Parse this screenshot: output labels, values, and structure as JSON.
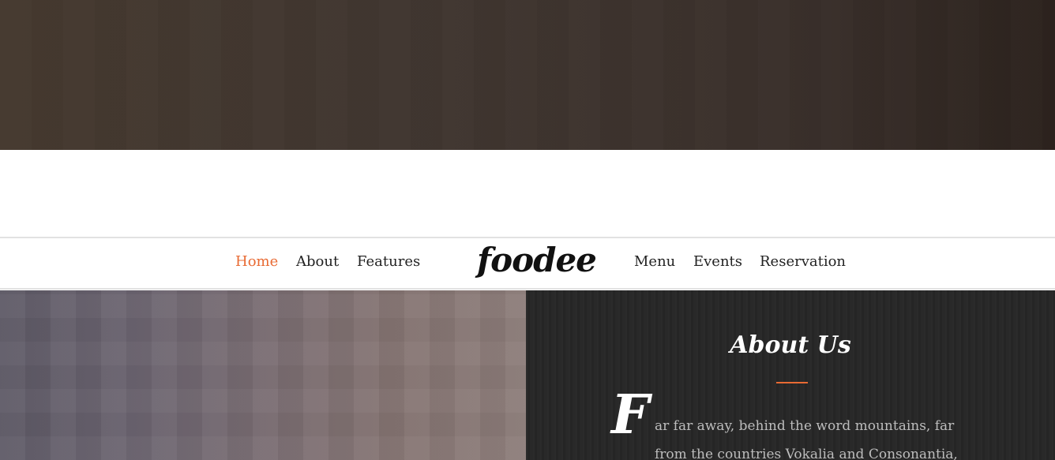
{
  "navbar": {
    "left_links": [
      "Home",
      "About",
      "Features"
    ],
    "logo": "foodee",
    "right_links": [
      "Menu",
      "Events",
      "Reservation"
    ],
    "active_link": "Home"
  },
  "about": {
    "title": "About Us",
    "drop_cap": "F",
    "lines": [
      "ar far away, behind the word mountains, far",
      "from the countries Vokalia and Consonantia,"
    ]
  },
  "colors": {
    "accent": "#e86a33",
    "nav_text": "#222222",
    "about_bg": "#262626"
  }
}
